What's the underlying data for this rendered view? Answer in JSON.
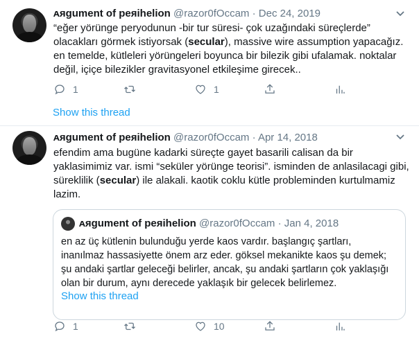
{
  "tweets": [
    {
      "name": "ᴀяgument of peяihelion",
      "handle": "@razor0fOccam",
      "sep": "·",
      "date": "Dec 24, 2019",
      "lines": [
        "“eğer yörünge peryodunun -bir tur süresi- çok uzağındaki süreçlerde”",
        [
          "olacakları görmek istiyorsak (",
          "secular",
          "), massive wire assumption yapacağız."
        ],
        "en temelde, kütleleri yörüngeleri boyunca bir bilezik gibi ufalamak. noktalar",
        "değil, içiçe bilezikler gravitasyonel etkileşime girecek.."
      ],
      "replies": "1",
      "retweets": "",
      "likes": "1",
      "show_thread": "Show this thread"
    },
    {
      "name": "ᴀяgument of peяihelion",
      "handle": "@razor0fOccam",
      "sep": "·",
      "date": "Apr 14, 2018",
      "lines": [
        "efendim ama bugüne kadarki süreçte gayet basarili calisan da bir",
        "yaklasimimiz var. ismi “seküler yörünge teorisi”. isminden de anlasilacagi gibi,",
        [
          "süreklilik (",
          "secular",
          ") ile alakali. kaotik coklu kütle probleminden kurtulmamiz"
        ],
        "lazim."
      ],
      "replies": "1",
      "retweets": "",
      "likes": "10",
      "quote": {
        "name": "ᴀяgument of peяihelion",
        "handle": "@razor0fOccam",
        "sep": "·",
        "date": "Jan 4, 2018",
        "lines": [
          "en az üç kütlenin bulunduğu yerde kaos vardır. başlangıç şartları,",
          "inanılmaz hassasiyette önem arz eder. göksel mekanikte kaos şu demek;",
          "şu andaki şartlar geleceği belirler, ancak, şu andaki şartların çok yaklaşığı",
          "olan bir durum, aynı derecede yaklaşık bir gelecek belirlemez."
        ],
        "show_thread": "Show this thread"
      }
    }
  ],
  "icons": {
    "reply": "reply-icon",
    "retweet": "retweet-icon",
    "like": "heart-icon",
    "analytics": "analytics-icon",
    "more": "chevron-down-icon"
  },
  "colors": {
    "link": "#1da1f2",
    "muted": "#657786",
    "divider": "#e6ecf0"
  }
}
